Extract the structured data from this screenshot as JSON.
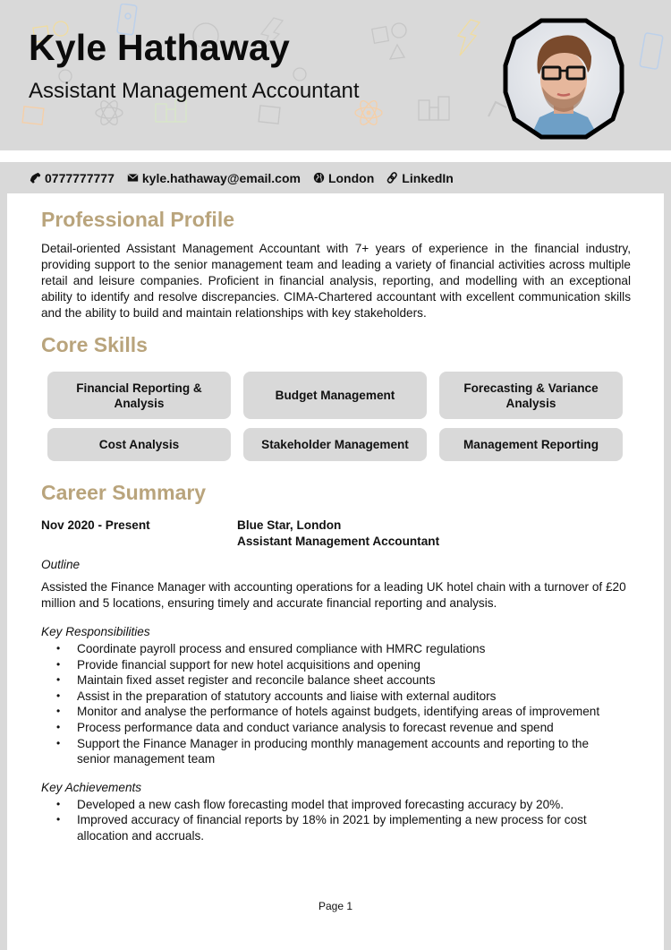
{
  "header": {
    "name": "Kyle Hathaway",
    "job_title": "Assistant Management Accountant",
    "photo_alt": "Profile photo of Kyle Hathaway"
  },
  "contact": {
    "phone": {
      "icon": "phone-icon",
      "text": "0777777777"
    },
    "email": {
      "icon": "envelope-icon",
      "text": "kyle.hathaway@email.com"
    },
    "location": {
      "icon": "globe-icon",
      "text": "London"
    },
    "linkedin": {
      "icon": "link-icon",
      "text": "LinkedIn"
    }
  },
  "colors": {
    "accent": "#b9a47c",
    "band": "#d9d9d9",
    "text": "#111111"
  },
  "profile": {
    "heading": "Professional Profile",
    "text": "Detail-oriented Assistant Management Accountant with 7+ years of experience in the financial industry, providing support to the senior management team and leading a variety of financial activities across multiple retail and leisure companies. Proficient in financial analysis, reporting, and modelling with an exceptional ability to identify and resolve discrepancies. CIMA-Chartered accountant with excellent communication skills and the ability to build and maintain relationships with key stakeholders."
  },
  "skills": {
    "heading": "Core Skills",
    "items": [
      "Financial Reporting & Analysis",
      "Budget Management",
      "Forecasting & Variance Analysis",
      "Cost Analysis",
      "Stakeholder Management",
      "Management Reporting"
    ]
  },
  "career": {
    "heading": "Career Summary",
    "jobs": [
      {
        "dates": "Nov 2020 - Present",
        "company": "Blue Star, London",
        "role": "Assistant Management Accountant",
        "outline_label": "Outline",
        "outline": "Assisted the Finance Manager with accounting operations for a leading UK hotel chain with a turnover of £20 million and 5 locations, ensuring timely and accurate financial reporting and analysis.",
        "responsibilities_label": "Key Responsibilities",
        "responsibilities": [
          "Coordinate payroll process and ensured compliance with HMRC regulations",
          "Provide financial support for new hotel acquisitions and opening",
          "Maintain fixed asset register and reconcile balance sheet accounts",
          "Assist in the preparation of statutory accounts and liaise with external auditors",
          "Monitor and analyse the performance of hotels against budgets, identifying areas of improvement",
          "Process performance data and conduct variance analysis to forecast revenue and spend",
          "Support the Finance Manager in producing monthly management accounts and reporting to the senior management team"
        ],
        "achievements_label": "Key Achievements",
        "achievements": [
          "Developed a new cash flow forecasting model that improved forecasting accuracy by 20%.",
          "Improved accuracy of financial reports by 18% in 2021 by implementing a new process for cost allocation and accruals."
        ]
      }
    ]
  },
  "footer": {
    "page": "Page 1"
  }
}
